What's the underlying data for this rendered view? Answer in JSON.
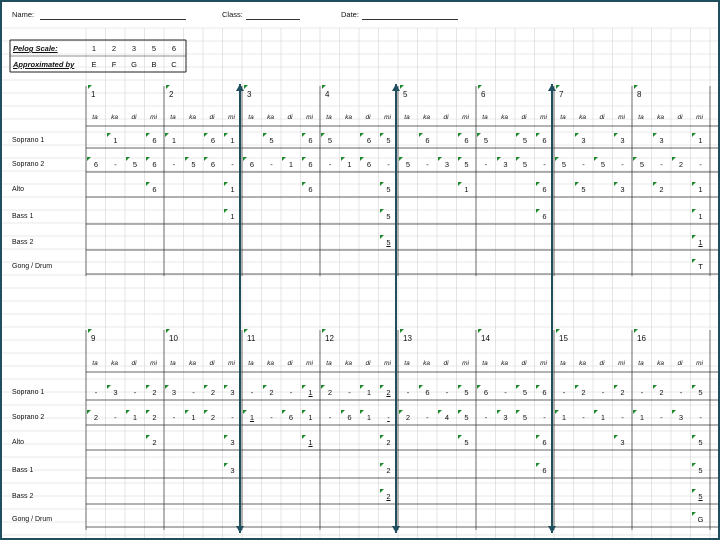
{
  "header": {
    "name_label": "Name:",
    "class_label": "Class:",
    "date_label": "Date:"
  },
  "scale_box": {
    "row1_label": "Pelog Scale:",
    "row2_label": "Approximated by",
    "degrees": [
      "1",
      "2",
      "3",
      "5",
      "6"
    ],
    "notes": [
      "E",
      "F",
      "G",
      "B",
      "C"
    ]
  },
  "syllables": [
    "ta",
    "ka",
    "di",
    "mi"
  ],
  "parts": [
    "Soprano 1",
    "Soprano 2",
    "Alto",
    "Bass 1",
    "Bass 2",
    "Gong / Drum"
  ],
  "sections": [
    {
      "measures": [
        "1",
        "2",
        "3",
        "4",
        "5",
        "6",
        "7",
        "8"
      ],
      "soprano1": [
        "",
        "1",
        "",
        "6",
        "1",
        "",
        "6",
        "1",
        "",
        "5",
        "",
        "6",
        "5",
        "",
        "6",
        "5",
        "",
        "6",
        "",
        "6",
        "5",
        "",
        "5",
        "6",
        "",
        "3",
        "",
        "3",
        "",
        "3",
        "",
        "1"
      ],
      "soprano2": [
        "6",
        "-",
        "5",
        "6",
        "-",
        "5",
        "6",
        "-",
        "6",
        "-",
        "1",
        "6",
        "-",
        "1",
        "6",
        "-",
        "5",
        "-",
        "3",
        "5",
        "-",
        "3",
        "5",
        "-",
        "5",
        "-",
        "5",
        "-",
        "5",
        "-",
        "2",
        "-"
      ],
      "alto": [
        "",
        "",
        "",
        "6",
        "",
        "",
        "",
        "1",
        "",
        "",
        "",
        "6",
        "",
        "",
        "",
        "5",
        "",
        "",
        "",
        "1",
        "",
        "",
        "",
        "6",
        "",
        "5",
        "",
        "3",
        "",
        "2",
        "",
        "1"
      ],
      "bass1": [
        "",
        "",
        "",
        "",
        "",
        "",
        "",
        "1",
        "",
        "",
        "",
        "",
        "",
        "",
        "",
        "5",
        "",
        "",
        "",
        "",
        "",
        "",
        "",
        "6",
        "",
        "",
        "",
        "",
        "",
        "",
        "",
        "1"
      ],
      "bass2": [
        "",
        "",
        "",
        "",
        "",
        "",
        "",
        "",
        "",
        "",
        "",
        "",
        "",
        "",
        "",
        "5",
        "",
        "",
        "",
        "",
        "",
        "",
        "",
        "",
        "",
        "",
        "",
        "",
        "",
        "",
        "",
        "1"
      ],
      "gong": [
        "",
        "",
        "",
        "",
        "",
        "",
        "",
        "",
        "",
        "",
        "",
        "",
        "",
        "",
        "",
        "",
        "",
        "",
        "",
        "",
        "",
        "",
        "",
        "",
        "",
        "",
        "",
        "",
        "",
        "",
        "",
        "T"
      ]
    },
    {
      "measures": [
        "9",
        "10",
        "11",
        "12",
        "13",
        "14",
        "15",
        "16"
      ],
      "soprano1": [
        "-",
        "3",
        "-",
        "2",
        "3",
        "-",
        "2",
        "3",
        "-",
        "2",
        "-",
        "1",
        "2",
        "-",
        "1",
        "2",
        "-",
        "6",
        "-",
        "5",
        "6",
        "-",
        "5",
        "6",
        "-",
        "2",
        "-",
        "2",
        "-",
        "2",
        "-",
        "5"
      ],
      "soprano2": [
        "2",
        "-",
        "1",
        "2",
        "-",
        "1",
        "2",
        "-",
        "1",
        "-",
        "6",
        "1",
        "-",
        "6",
        "1",
        "-",
        "2",
        "-",
        "4",
        "5",
        "-",
        "3",
        "5",
        "-",
        "1",
        "-",
        "1",
        "-",
        "1",
        "-",
        "3",
        "-"
      ],
      "alto": [
        "",
        "",
        "",
        "2",
        "",
        "",
        "",
        "3",
        "",
        "",
        "",
        "1",
        "",
        "",
        "",
        "2",
        "",
        "",
        "",
        "5",
        "",
        "",
        "",
        "6",
        "",
        "",
        "",
        "3",
        "",
        "",
        "",
        "5"
      ],
      "bass1": [
        "",
        "",
        "",
        "",
        "",
        "",
        "",
        "3",
        "",
        "",
        "",
        "",
        "",
        "",
        "",
        "2",
        "",
        "",
        "",
        "",
        "",
        "",
        "",
        "6",
        "",
        "",
        "",
        "",
        "",
        "",
        "",
        "5"
      ],
      "bass2": [
        "",
        "",
        "",
        "",
        "",
        "",
        "",
        "",
        "",
        "",
        "",
        "",
        "",
        "",
        "",
        "2",
        "",
        "",
        "",
        "",
        "",
        "",
        "",
        "",
        "",
        "",
        "",
        "",
        "",
        "",
        "",
        "5"
      ],
      "gong": [
        "",
        "",
        "",
        "",
        "",
        "",
        "",
        "",
        "",
        "",
        "",
        "",
        "",
        "",
        "",
        "",
        "",
        "",
        "",
        "",
        "",
        "",
        "",
        "",
        "",
        "",
        "",
        "",
        "",
        "",
        "",
        "G"
      ]
    }
  ],
  "colors": {
    "frame": "#1f4e5f",
    "arrow": "#1f4e5f",
    "grid": "#d4d4d4",
    "corner_tag": "#1e8a2e"
  }
}
